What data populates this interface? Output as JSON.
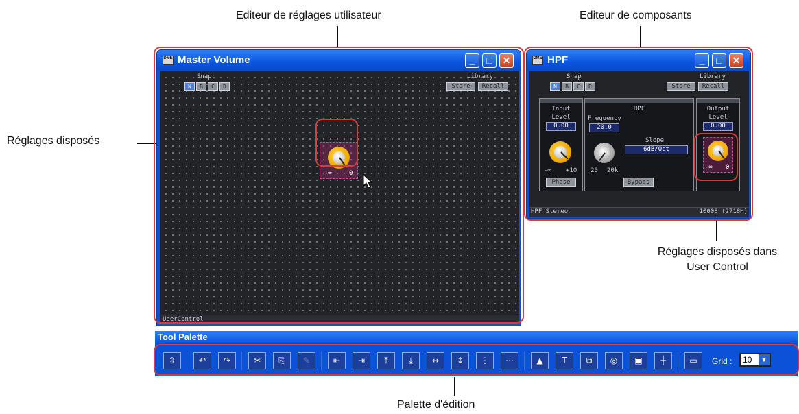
{
  "callouts": {
    "user_editor": "Editeur de réglages utilisateur",
    "component_editor": "Editeur de composants",
    "placed_controls": "Réglages disposés",
    "placed_in_user_control": "Réglages disposés dans\nUser Control",
    "edit_palette": "Palette d'édition"
  },
  "master_window": {
    "title": "Master Volume",
    "snap_label": "Snap",
    "snap_buttons": [
      "N",
      "B",
      "C",
      "D"
    ],
    "library_label": "Library",
    "store": "Store",
    "recall": "Recall",
    "knob_min": "-∞",
    "knob_max": "0",
    "status": "UserControl"
  },
  "hpf_window": {
    "title": "HPF",
    "snap_label": "Snap",
    "snap_buttons": [
      "N",
      "B",
      "C",
      "D"
    ],
    "library_label": "Library",
    "store": "Store",
    "recall": "Recall",
    "input_label": "Input",
    "input_level_label": "Level",
    "input_level_value": "0.00",
    "input_min": "-∞",
    "input_max": "+10",
    "phase": "Phase",
    "hpf_label": "HPF",
    "frequency_label": "Frequency",
    "frequency_value": "20.0",
    "freq_min": "20",
    "freq_max": "20k",
    "slope_label": "Slope",
    "slope_value": "6dB/Oct",
    "bypass": "Bypass",
    "output_label": "Output",
    "output_level_label": "Level",
    "output_level_value": "0.00",
    "output_min": "-∞",
    "output_max": "0",
    "status_left": "HPF  Stereo",
    "status_right": "10008 (2718H)"
  },
  "tool_palette": {
    "title": "Tool Palette",
    "grid_label": "Grid :",
    "grid_value": "10"
  }
}
